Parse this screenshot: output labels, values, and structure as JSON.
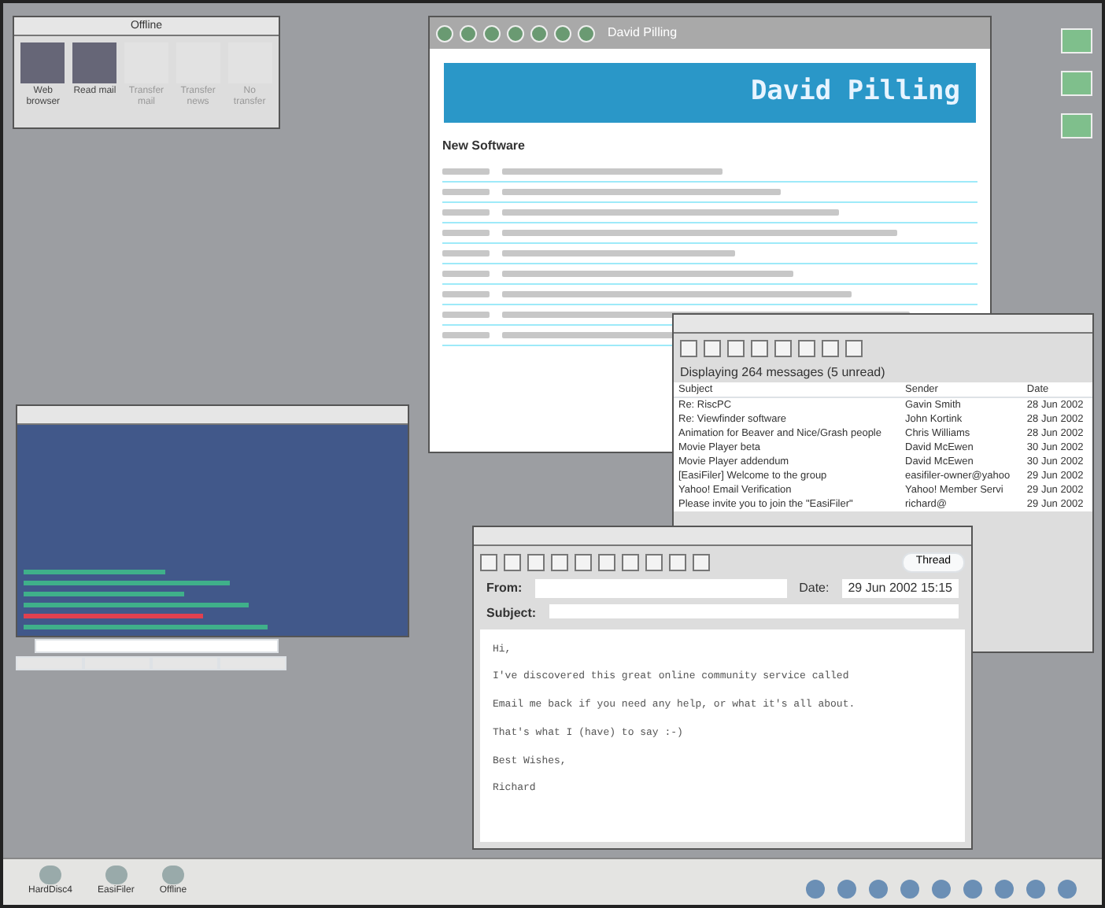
{
  "launcher_window": {
    "title": "Offline",
    "buttons": [
      {
        "label": "Web browser",
        "disabled": false
      },
      {
        "label": "Read mail",
        "disabled": false
      },
      {
        "label": "Transfer mail",
        "disabled": true
      },
      {
        "label": "Transfer news",
        "disabled": true
      },
      {
        "label": "No transfer",
        "disabled": true
      }
    ]
  },
  "browser_window": {
    "title": "David Pilling",
    "banner_title": "David Pilling",
    "heading": "New Software"
  },
  "mail_list_window": {
    "status": "Displaying 264 messages (5 unread)",
    "columns": [
      "Subject",
      "Sender",
      "Date"
    ],
    "rows": [
      {
        "subject": "Re: RiscPC",
        "sender": "Gavin Smith",
        "date": "28 Jun 2002"
      },
      {
        "subject": "Re: Viewfinder software",
        "sender": "John Kortink",
        "date": "28 Jun 2002"
      },
      {
        "subject": "Animation for Beaver and Nice/Grash people",
        "sender": "Chris Williams",
        "date": "28 Jun 2002"
      },
      {
        "subject": "Movie Player beta",
        "sender": "David McEwen",
        "date": "30 Jun 2002"
      },
      {
        "subject": "Movie Player addendum",
        "sender": "David McEwen",
        "date": "30 Jun 2002"
      },
      {
        "subject": "[EasiFiler] Welcome to the group",
        "sender": "easifiler-owner@yahoo",
        "date": "29 Jun 2002"
      },
      {
        "subject": "Yahoo! Email Verification",
        "sender": "Yahoo! Member Servi",
        "date": "29 Jun 2002"
      },
      {
        "subject": "Please invite you to join the \"EasiFiler\"",
        "sender": "richard@",
        "date": "29 Jun 2002"
      }
    ]
  },
  "message_window": {
    "thread_button": "Thread",
    "from_label": "From:",
    "date_label": "Date:",
    "date": "29 Jun 2002 15:15",
    "subject_label": "Subject:",
    "body": [
      "Hi,",
      "I've discovered this great online community service called",
      "Email me back if you need any help, or what it's all about.",
      "That's what I (have) to say :-)",
      "Best Wishes,",
      "Richard"
    ]
  },
  "console_window": {
    "lines": [
      {
        "color": "#3fb08a"
      },
      {
        "color": "#3fb08a"
      },
      {
        "color": "#3fb08a"
      },
      {
        "color": "#3fb08a"
      },
      {
        "color": "#e04050"
      },
      {
        "color": "#3fb08a"
      }
    ]
  },
  "taskbar": {
    "items": [
      "HardDisc4",
      "EasiFiler",
      "Offline"
    ]
  }
}
